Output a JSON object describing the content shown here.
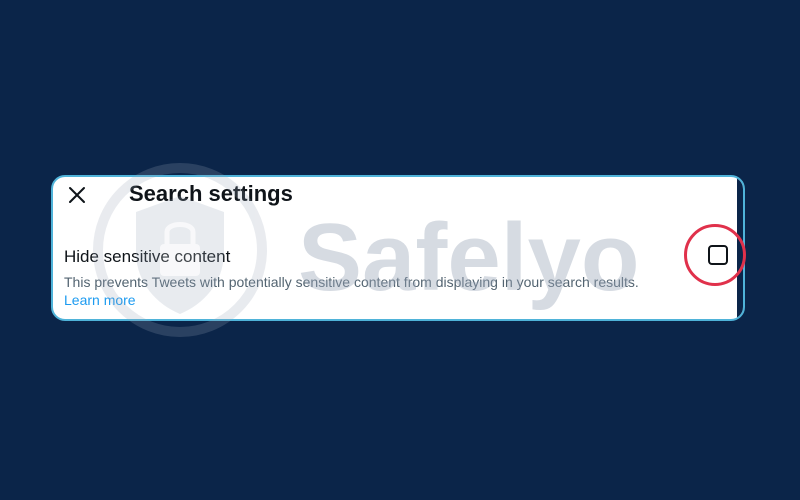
{
  "dialog": {
    "title": "Search settings",
    "close_icon": "close-icon"
  },
  "setting": {
    "label": "Hide sensitive content",
    "description": "This prevents Tweets with potentially sensitive content from displaying in your search results.",
    "learn_more": "Learn more",
    "checked": false
  },
  "watermark": {
    "text": "Safelyo",
    "icon": "shield-lock-icon"
  },
  "colors": {
    "background": "#0b2549",
    "panel": "#ffffff",
    "panel_border": "#4fb3d9",
    "title_text": "#0f1419",
    "secondary_text": "#536471",
    "link": "#1d9bf0",
    "highlight": "#e0314b"
  }
}
